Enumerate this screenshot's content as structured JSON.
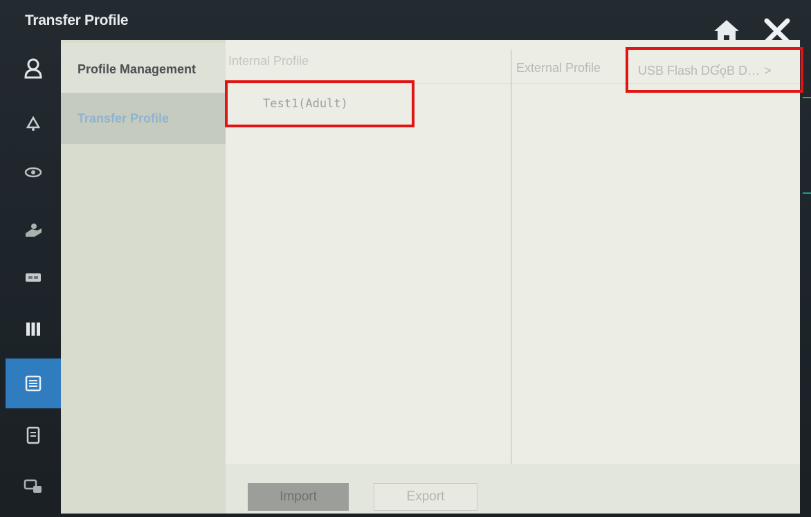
{
  "window": {
    "title": "Transfer Profile"
  },
  "icons": {
    "home": "home-icon",
    "close": "close-icon"
  },
  "rail": {
    "items": [
      {
        "icon": "person-icon"
      },
      {
        "icon": "alarm-bell-icon"
      },
      {
        "icon": "eye-icon"
      },
      {
        "icon": "hand-icon"
      },
      {
        "icon": "module-icon"
      },
      {
        "icon": "parameter-columns-icon"
      },
      {
        "icon": "profile-config-icon",
        "active": true
      },
      {
        "icon": "document-icon"
      },
      {
        "icon": "network-icon"
      }
    ],
    "active_color": "#2f7dbf"
  },
  "subnav": {
    "items": [
      {
        "label": "Profile Management"
      },
      {
        "label": "Transfer Profile",
        "active": true
      }
    ]
  },
  "internal": {
    "title": "Internal Profile",
    "profiles": [
      "Test1(Adult)"
    ]
  },
  "external": {
    "title": "External Profile",
    "device_select": "USB Flash D",
    "device_select_overlap": "ƓǫB D…",
    "chevron": ">"
  },
  "actions": {
    "import_label": "Import",
    "export_label": "Export"
  },
  "colors": {
    "highlight": "#e01414",
    "panel_bg": "#e9ebe2",
    "frame_bg": "#1d2429"
  }
}
